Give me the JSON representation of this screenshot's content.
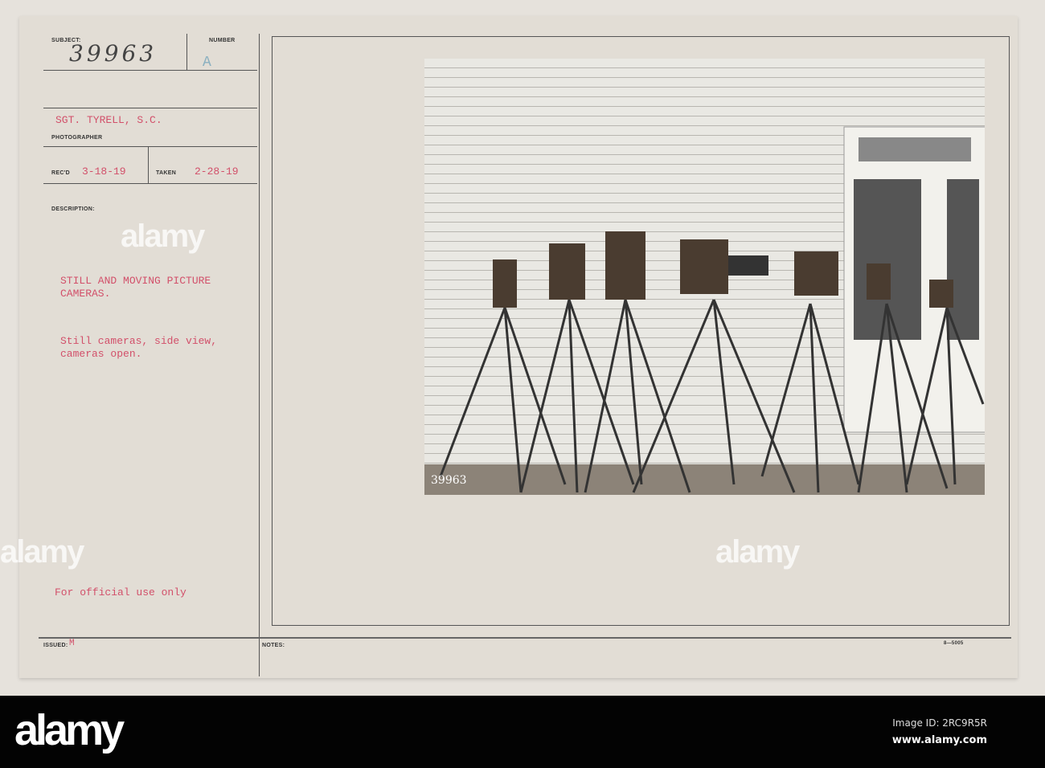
{
  "card": {
    "subject_label": "SUBJECT:",
    "subject_number": "39963",
    "number_label": "NUMBER",
    "number_value": "A",
    "photographer": "SGT. TYRELL, S.C.",
    "photographer_label": "PHOTOGRAPHER",
    "recd_label": "REC'D",
    "recd_date": "3-18-19",
    "taken_label": "TAKEN",
    "taken_date": "2-28-19",
    "description_label": "DESCRIPTION:",
    "description_title_1": "STILL AND MOVING PICTURE",
    "description_title_2": "CAMERAS.",
    "description_body_1": "Still cameras, side view,",
    "description_body_2": "cameras open.",
    "official": "For  official use only",
    "issued_label": "ISSUED:",
    "issued_value": "M",
    "notes_label": "NOTES:",
    "form_code": "8—5005"
  },
  "photo": {
    "negative_number": "39963"
  },
  "footer": {
    "logo": "alamy",
    "image_id": "Image ID: 2RC9R5R",
    "url": "www.alamy.com"
  }
}
